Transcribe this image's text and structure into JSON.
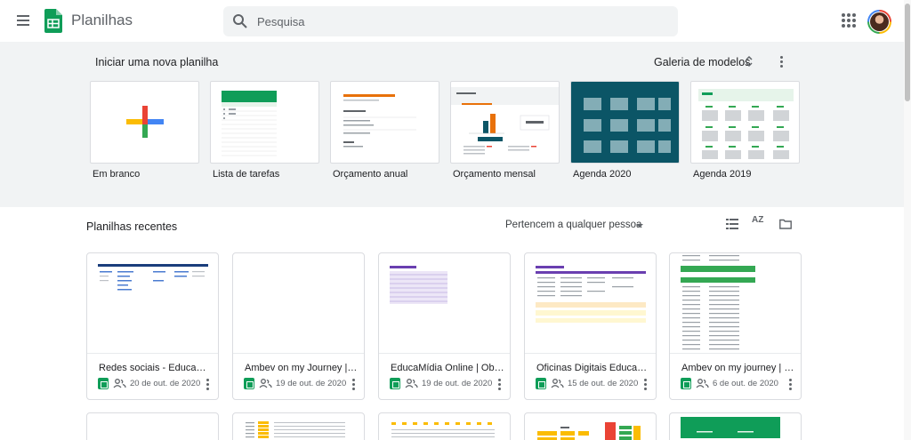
{
  "header": {
    "app_title": "Planilhas",
    "search_placeholder": "Pesquisa"
  },
  "gallery": {
    "title": "Iniciar uma nova planilha",
    "models_label": "Galeria de modelos",
    "templates": [
      {
        "label": "Em branco"
      },
      {
        "label": "Lista de tarefas"
      },
      {
        "label": "Orçamento anual"
      },
      {
        "label": "Orçamento mensal"
      },
      {
        "label": "Agenda 2020"
      },
      {
        "label": "Agenda 2019"
      }
    ]
  },
  "recent": {
    "title": "Planilhas recentes",
    "owner_filter": "Pertencem a qualquer pessoa",
    "sort_label": "AZ",
    "files": [
      {
        "name": "Redes sociais - Educamídia",
        "date": "20 de out. de 2020"
      },
      {
        "name": "Ambev on my Journey | Jornada",
        "date": "19 de out. de 2020"
      },
      {
        "name": "EducaMídia Online | Objetivos",
        "date": "19 de out. de 2020"
      },
      {
        "name": "Oficinas Digitais Educamídia",
        "date": "15 de out. de 2020"
      },
      {
        "name": "Ambev on my journey | relatório",
        "date": "6 de out. de 2020"
      }
    ]
  },
  "colors": {
    "sheets_green": "#0f9d58",
    "gallery_bg": "#f1f3f4",
    "calendar_teal": "#0b5566"
  }
}
